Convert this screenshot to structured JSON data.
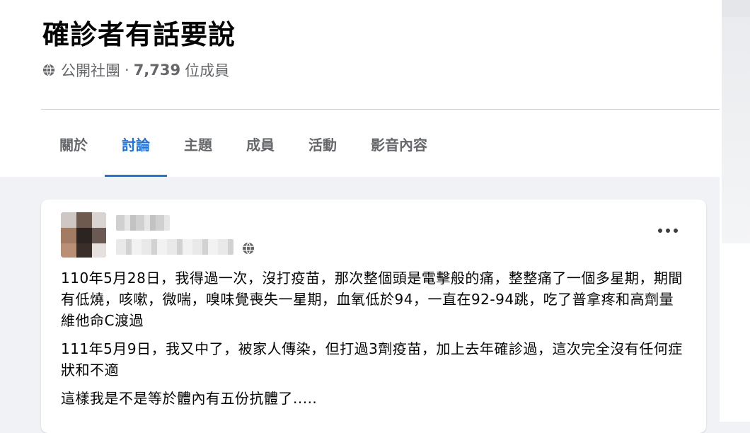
{
  "group": {
    "title": "確診者有話要說",
    "privacy": "公開社團",
    "separator": "·",
    "member_count": "7,739",
    "member_label": "位成員"
  },
  "tabs": [
    {
      "label": "關於",
      "active": false
    },
    {
      "label": "討論",
      "active": true
    },
    {
      "label": "主題",
      "active": false
    },
    {
      "label": "成員",
      "active": false
    },
    {
      "label": "活動",
      "active": false
    },
    {
      "label": "影音內容",
      "active": false
    }
  ],
  "post": {
    "author_name": "",
    "paragraphs": [
      "110年5月28日，我得過一次，沒打疫苗，那次整個頭是電擊般的痛，整整痛了一個多星期，期間有低燒，咳嗽，微喘，嗅味覺喪失一星期，血氧低於94，一直在92-94跳，吃了普拿疼和高劑量維他命C渡過",
      "111年5月9日，我又中了，被家人傳染，但打過3劑疫苗，加上去年確診過，這次完全沒有任何症狀和不適",
      "這樣我是不是等於體內有五份抗體了....."
    ]
  },
  "icons": {
    "privacy": "globe-icon",
    "post_privacy": "globe-icon",
    "more": "more-options-icon"
  },
  "colors": {
    "accent": "#1b74e4",
    "page_background": "#f0f2f5",
    "secondary_text": "#65676b"
  }
}
